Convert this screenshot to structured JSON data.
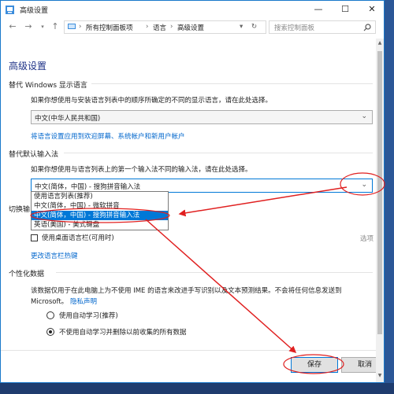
{
  "window": {
    "title": "高级设置",
    "minimize_glyph": "—",
    "maximize_glyph": "☐",
    "close_glyph": "✕"
  },
  "address": {
    "breadcrumbs": [
      "所有控制面板项",
      "语言",
      "高级设置"
    ],
    "separator": "›",
    "search_placeholder": "搜索控制面板"
  },
  "page": {
    "heading": "高级设置",
    "display_language": {
      "title": "替代 Windows 显示语言",
      "description": "如果你想使用与安装语言列表中的顺序所确定的不同的显示语言，请在此处选择。",
      "selected": "中文(中华人民共和国)",
      "link": "将语言设置应用到欢迎屏幕、系统帐户和新用户帐户"
    },
    "input_method": {
      "title": "替代默认输入法",
      "description": "如果你想使用与语言列表上的第一个输入法不同的输入法，请在此处选择。",
      "selected": "中文(简体，中国) - 搜狗拼音输入法",
      "options": [
        "使用语言列表(推荐)",
        "中文(简体，中国) - 微软拼音",
        "中文(简体，中国) - 搜狗拼音输入法",
        "英语(美国) - 美式键盘"
      ],
      "highlighted_index": 2
    },
    "switch_section": {
      "title_fragment": "切换输",
      "option_text": "使用桌面语言栏(可用时)",
      "options_link": "选项",
      "hotkey_link": "更改语言栏热键"
    },
    "personalization": {
      "title": "个性化数据",
      "description_line1": "该数据仅用于在此电脑上为不使用 IME 的语言来改进手写识别以及文本预测结果。不会将任何信息发送到",
      "description_line2": "Microsoft。",
      "privacy_link": "隐私声明",
      "radio_auto": "使用自动学习(推荐)",
      "radio_noauto": "不使用自动学习并删除以前收集的所有数据",
      "selected_radio": "noauto"
    },
    "buttons": {
      "save": "保存",
      "cancel": "取消"
    }
  },
  "colors": {
    "accent": "#0078d7",
    "annotation": "#e02020",
    "link": "#0066cc",
    "heading": "#1e3287"
  }
}
